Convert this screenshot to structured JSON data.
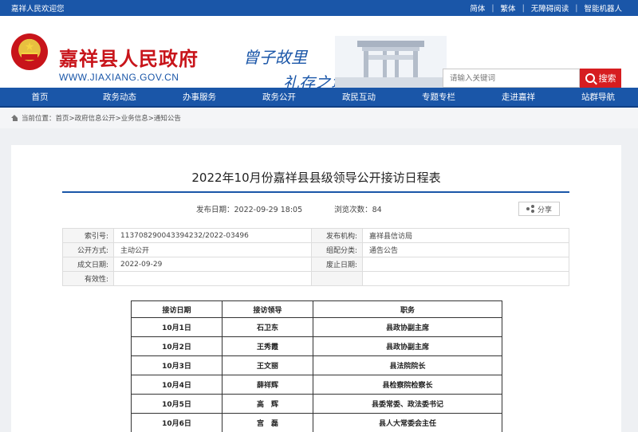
{
  "topbar": {
    "welcome": "嘉祥人民欢迎您",
    "links": [
      "简体",
      "繁体",
      "无障碍阅读",
      "智能机器人"
    ]
  },
  "header": {
    "title": "嘉祥县人民政府",
    "url": "WWW.JIAXIANG.GOV.CN",
    "slogan_line1": "曾子故里",
    "slogan_line2": "礼存之城",
    "search": {
      "placeholder": "请输入关键词",
      "button_label": "搜索"
    }
  },
  "nav": [
    "首页",
    "政务动态",
    "办事服务",
    "政务公开",
    "政民互动",
    "专题专栏",
    "走进嘉祥",
    "站群导航"
  ],
  "breadcrumb": "当前位置：首页>政府信息公开>业务信息>通知公告",
  "article": {
    "title": "2022年10月份嘉祥县县级领导公开接访日程表",
    "publish_date": "发布日期：2022-09-29 18:05",
    "views": "浏览次数：84",
    "share_label": "分享"
  },
  "info_table": [
    [
      "索引号:",
      "11370829004339423​2/2022-03496",
      "发布机构:",
      "嘉祥县信访局"
    ],
    [
      "公开方式:",
      "主动公开",
      "组配分类:",
      "通告公告"
    ],
    [
      "成文日期:",
      "2022-09-29",
      "废止日期:",
      ""
    ],
    [
      "有效性:",
      "",
      "",
      ""
    ]
  ],
  "schedule": {
    "headers": [
      "接访日期",
      "接访领导",
      "职务"
    ],
    "rows": [
      [
        "10月1日",
        "石卫东",
        "县政协副主席"
      ],
      [
        "10月2日",
        "王秀霞",
        "县政协副主席"
      ],
      [
        "10月3日",
        "王文丽",
        "县法院院长"
      ],
      [
        "10月4日",
        "薛祥辉",
        "县检察院检察长"
      ],
      [
        "10月5日",
        "高　辉",
        "县委常委、政法委书记"
      ],
      [
        "10月6日",
        "宫　磊",
        "县人大常委会主任"
      ]
    ]
  },
  "colors": {
    "primary_blue": "#1a56a8",
    "brand_red": "#c8141a",
    "search_red": "#d61d20"
  }
}
